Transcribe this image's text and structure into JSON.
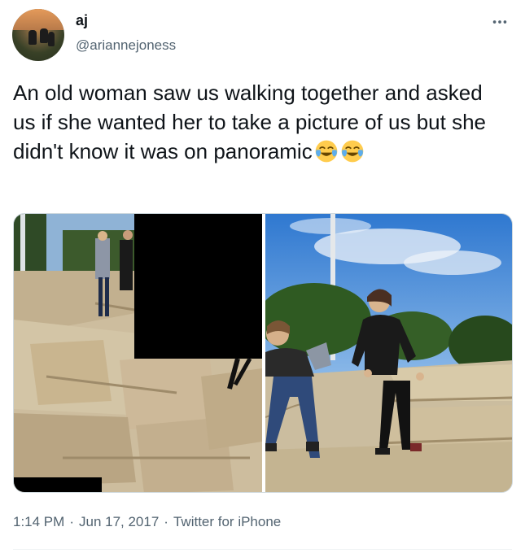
{
  "tweet": {
    "author_name": "aj",
    "author_handle": "@ariannejoness",
    "text": "An old woman saw us walking together and asked us if she wanted her to take a picture of us but she didn't know it was on panoramic",
    "emojis": [
      "face-with-tears-of-joy",
      "face-with-tears-of-joy"
    ],
    "time": "1:14 PM",
    "date": "Jun 17, 2017",
    "source": "Twitter for iPhone",
    "meta_separator": "·"
  },
  "colors": {
    "text": "#0f1419",
    "secondary": "#536471",
    "border": "#cfd9de"
  }
}
